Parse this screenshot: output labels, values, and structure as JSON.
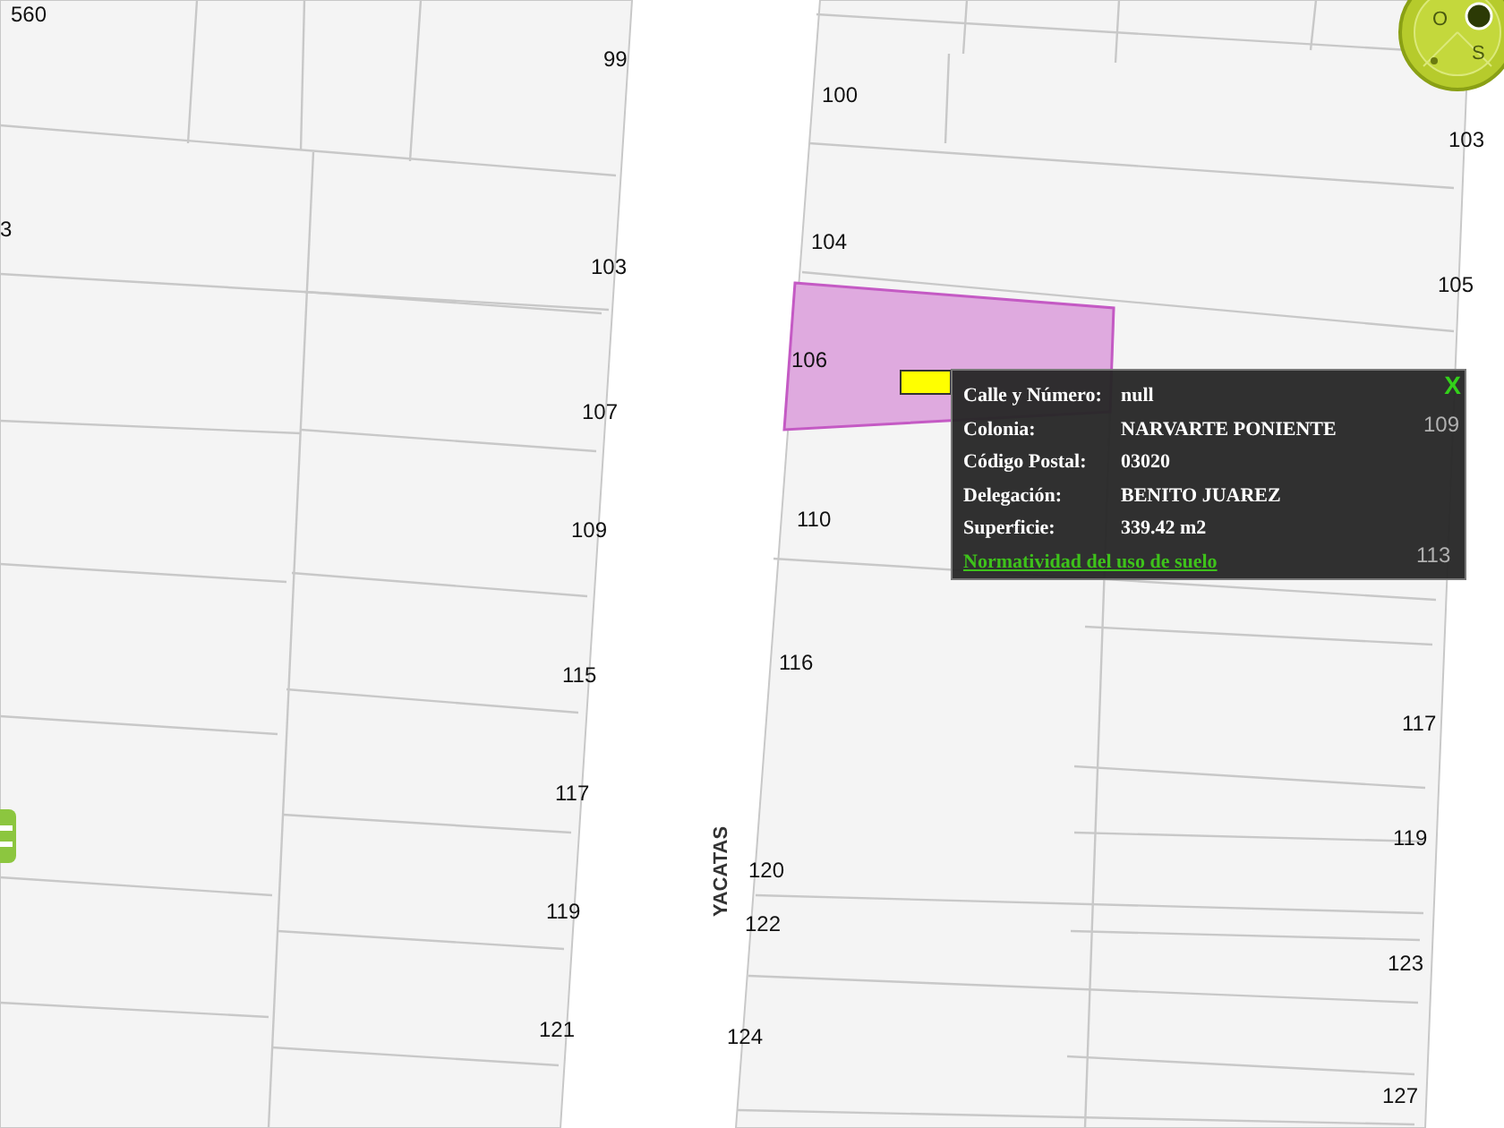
{
  "map": {
    "street_name": "YACATAS",
    "lot_numbers": [
      "560",
      "99",
      "3",
      "103",
      "107",
      "109",
      "115",
      "117",
      "119",
      "121",
      "100",
      "104",
      "106",
      "110",
      "116",
      "120",
      "122",
      "124",
      "103",
      "105",
      "109",
      "113",
      "117",
      "119",
      "123",
      "127"
    ]
  },
  "compass": {
    "labels": [
      "O",
      "S"
    ]
  },
  "info_popup": {
    "close": "X",
    "rows": [
      {
        "label": "Calle y Número:",
        "value": "null"
      },
      {
        "label": "Colonia:",
        "value": "NARVARTE PONIENTE"
      },
      {
        "label": "Código Postal:",
        "value": "03020"
      },
      {
        "label": "Delegación:",
        "value": "BENITO JUAREZ"
      },
      {
        "label": "Superficie:",
        "value": "339.42 m2"
      }
    ],
    "link": "Normatividad del uso de suelo"
  }
}
